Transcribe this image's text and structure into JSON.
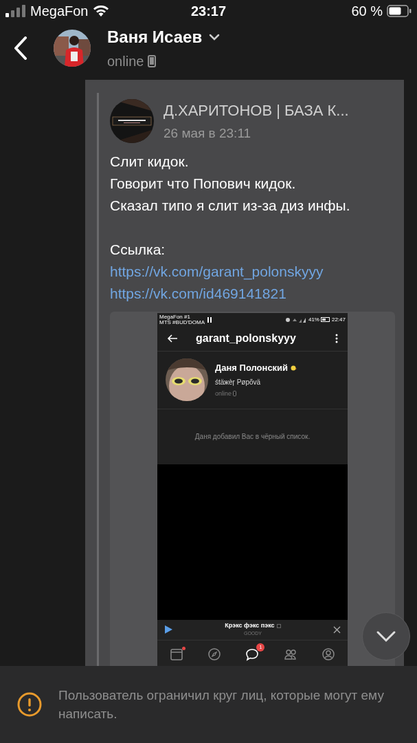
{
  "status_bar": {
    "carrier": "MegaFon",
    "time": "23:17",
    "battery": "60 %"
  },
  "header": {
    "name": "Ваня Исаев",
    "presence": "online"
  },
  "post": {
    "author": "Д.ХАРИТОНОВ | БАЗА К...",
    "date": "26 мая в 23:11",
    "paragraphs": [
      [
        "Слит кидок.",
        "Говорит что Попович кидок.",
        "Сказал типо я слит из-за диз инфы."
      ],
      [
        "Ссылка:"
      ]
    ],
    "links": [
      "https://vk.com/garant_polonskyyy",
      "https://vk.com/id469141821"
    ],
    "attachment": {
      "status": {
        "carrier_1": "MegaFon #1",
        "carrier_2": "MTS #BUD'DOMA",
        "battery": "41%",
        "time": "22:47"
      },
      "title": "garant_polonskyyy",
      "profile_name": "Даня Полонский",
      "profile_status": "śtäжèŗ Pøpõvä",
      "presence": "online",
      "notice": "Даня добавил Вас в чёрный список.",
      "player": {
        "track": "Крэкс фэкс пэкс",
        "artist": "GOODY"
      },
      "tabs": [
        {
          "kind": "feed",
          "selected": false,
          "dot": true
        },
        {
          "kind": "discover",
          "selected": false
        },
        {
          "kind": "messages",
          "selected": true,
          "badge": "1"
        },
        {
          "kind": "friends",
          "selected": false
        },
        {
          "kind": "profile",
          "selected": false
        }
      ]
    }
  },
  "notice": "Пользователь ограничил круг лиц, которые могут ему написать."
}
